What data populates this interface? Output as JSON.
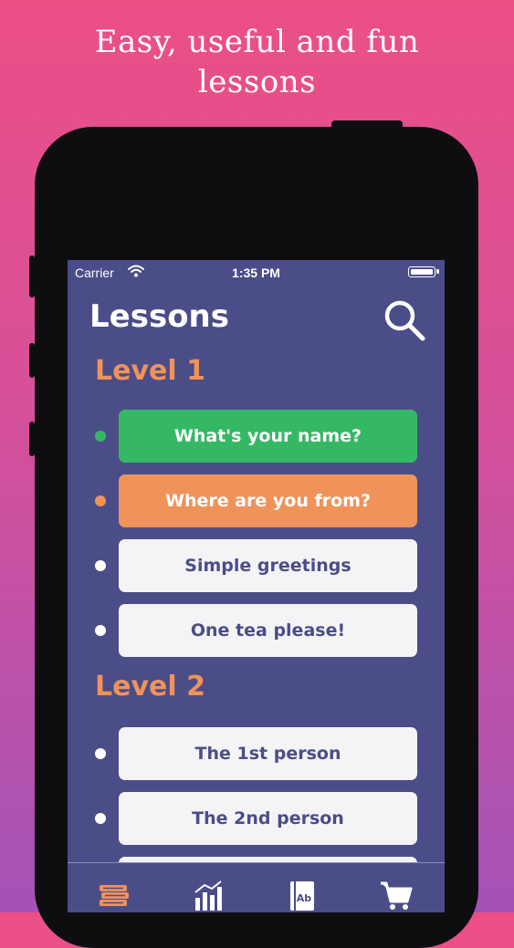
{
  "promo": {
    "line1": "Easy, useful and fun",
    "line2": "lessons"
  },
  "status_bar": {
    "carrier": "Carrier",
    "time": "1:35 PM"
  },
  "header": {
    "title": "Lessons",
    "search_icon": "search-icon"
  },
  "levels": [
    {
      "label": "Level 1",
      "lessons": [
        {
          "label": "What's your name?",
          "state": "completed",
          "color": "#35b864"
        },
        {
          "label": "Where are you from?",
          "state": "in-progress",
          "color": "#f0935a"
        },
        {
          "label": "Simple greetings",
          "state": "locked",
          "color": "#f4f4f6"
        },
        {
          "label": "One tea please!",
          "state": "locked",
          "color": "#f4f4f6"
        }
      ]
    },
    {
      "label": "Level 2",
      "lessons": [
        {
          "label": "The 1st person",
          "state": "locked",
          "color": "#f4f4f6"
        },
        {
          "label": "The 2nd person",
          "state": "locked",
          "color": "#f4f4f6"
        },
        {
          "label": "",
          "state": "locked",
          "color": "#f4f4f6"
        }
      ]
    }
  ],
  "tab_bar": {
    "tabs": [
      {
        "icon": "books-icon",
        "active": true
      },
      {
        "icon": "stats-chart-icon",
        "active": false
      },
      {
        "icon": "dictionary-icon",
        "icon_text": "Ab",
        "active": false
      },
      {
        "icon": "cart-icon",
        "active": false
      }
    ]
  },
  "colors": {
    "screen_bg": "#4b4d88",
    "accent": "#f0935a",
    "success": "#35b864"
  }
}
